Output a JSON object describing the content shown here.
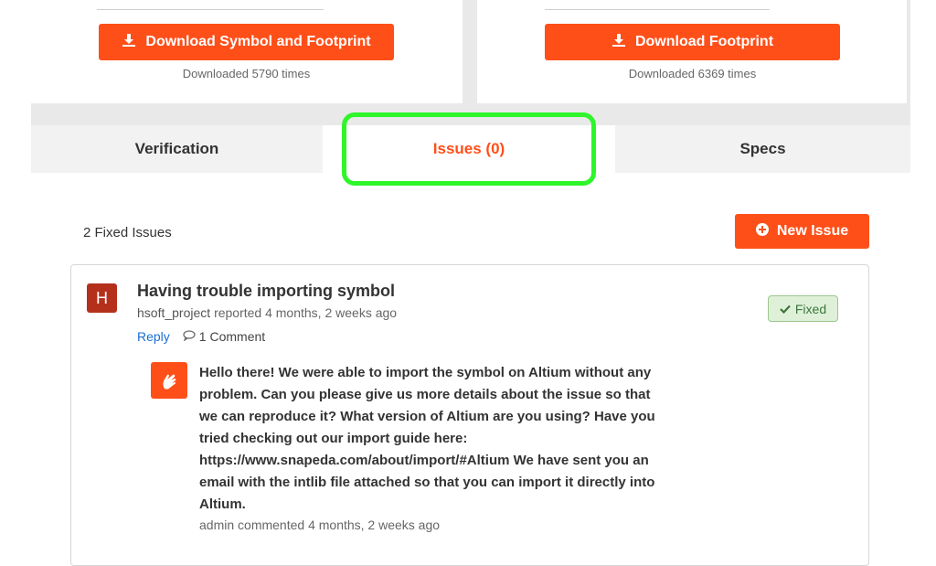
{
  "downloads": {
    "left": {
      "label": "Download Symbol and Footprint",
      "count": "Downloaded 5790 times"
    },
    "right": {
      "label": "Download Footprint",
      "count": "Downloaded 6369 times"
    }
  },
  "tabs": [
    {
      "label": "Verification"
    },
    {
      "label": "Issues (0)"
    },
    {
      "label": "Specs"
    }
  ],
  "issues_header": {
    "fixed_count": "2 Fixed Issues",
    "new_issue_label": "New Issue"
  },
  "issue": {
    "avatar_letter": "H",
    "title": "Having trouble importing symbol",
    "user": "hsoft_project",
    "reported": "reported 4 months, 2 weeks ago",
    "status": "Fixed",
    "reply_label": "Reply",
    "comments": "1 Comment",
    "comment": {
      "text": "Hello there! We were able to import the symbol on Altium without any problem. Can you please give us more details about the issue so that we can reproduce it? What version of Altium are you using? Have you tried checking out our import guide here: https://www.snapeda.com/about/import/#Altium We have sent you an email with the intlib file attached so that you can import it directly into Altium.",
      "user": "admin",
      "when": "commented 4 months, 2 weeks ago"
    }
  },
  "colors": {
    "accent": "#ff4f19",
    "highlight": "#2ff52b",
    "link": "#1a6fd0",
    "badge_bg": "#dff0d8"
  },
  "icons": [
    "download-icon",
    "plus-circle-icon",
    "check-icon",
    "comment-icon",
    "snapeda-logo-icon"
  ]
}
